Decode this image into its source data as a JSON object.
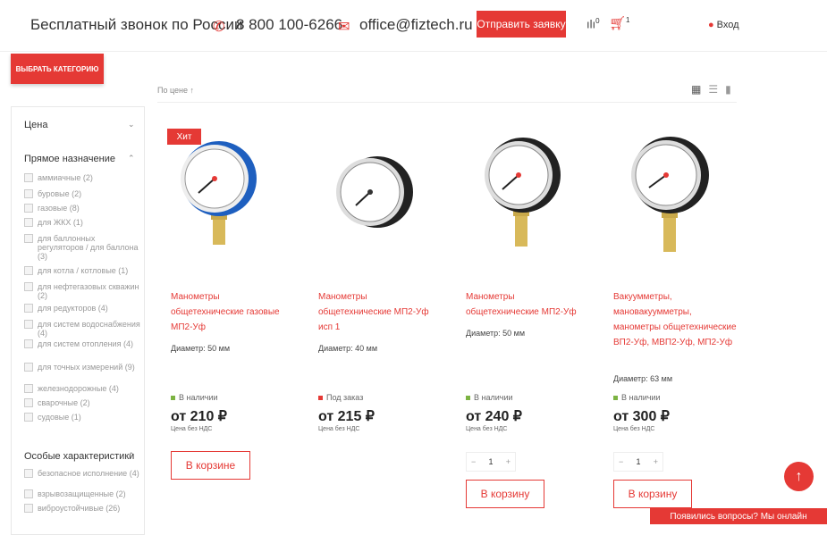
{
  "header": {
    "free_call": "Бесплатный звонок по России",
    "phone": "8 800 100-6266",
    "email": "office@fiztech.ru",
    "send_request": "Отправить заявку",
    "compare_count": "0",
    "cart_count": "1",
    "login": "Вход"
  },
  "toolbar": {
    "choose_category": "ВЫБРАТЬ КАТЕГОРИЮ",
    "sort": "По цене ↑"
  },
  "sidebar": {
    "price_title": "Цена",
    "purpose_title": "Прямое назначение",
    "purpose_items": [
      "аммиачные (2)",
      "буровые (2)",
      "газовые (8)",
      "для ЖКХ (1)",
      "для баллонных регуляторов / для баллона (3)",
      "для котла / котловые (1)",
      "для нефтегазовых скважин (2)",
      "для редукторов (4)",
      "для систем водоснабжения (4)",
      "для систем отопления (4)",
      "для точных измерений (9)",
      "железнодорожные (4)",
      "сварочные (2)",
      "судовые (1)"
    ],
    "features_title": "Особые характеристики",
    "features_items": [
      "безопасное исполнение (4)",
      "взрывозащищенные (2)",
      "виброустойчивые (26)"
    ]
  },
  "products": [
    {
      "badge": "Хит",
      "name": "Манометры общетехнические газовые МП2-Уф",
      "diameter": "Диаметр: 50 мм",
      "status": "В наличии",
      "status_color": "#7cb342",
      "price": "от 210 ₽",
      "vat": "Цена без НДС",
      "button": "В корзине"
    },
    {
      "name": "Манометры общетехнические МП2-Уф исп 1",
      "diameter": "Диаметр: 40 мм",
      "status": "Под заказ",
      "status_color": "#e53935",
      "price": "от 215 ₽",
      "vat": "Цена без НДС"
    },
    {
      "name": "Манометры общетехнические МП2-Уф",
      "diameter": "Диаметр: 50 мм",
      "status": "В наличии",
      "status_color": "#7cb342",
      "price": "от 240 ₽",
      "vat": "Цена без НДС",
      "qty": "1",
      "button": "В корзину"
    },
    {
      "name": "Вакуумметры, мановакуумметры, манометры общетехнические ВП2-Уф, МВП2-Уф, МП2-Уф",
      "diameter": "Диаметр: 63 мм",
      "status": "В наличии",
      "status_color": "#7cb342",
      "price": "от 300 ₽",
      "vat": "Цена без НДС",
      "qty": "1",
      "button": "В корзину"
    }
  ],
  "chat": "Появились вопросы? Мы онлайн",
  "colors": {
    "accent": "#e53935",
    "in_stock": "#7cb342"
  }
}
